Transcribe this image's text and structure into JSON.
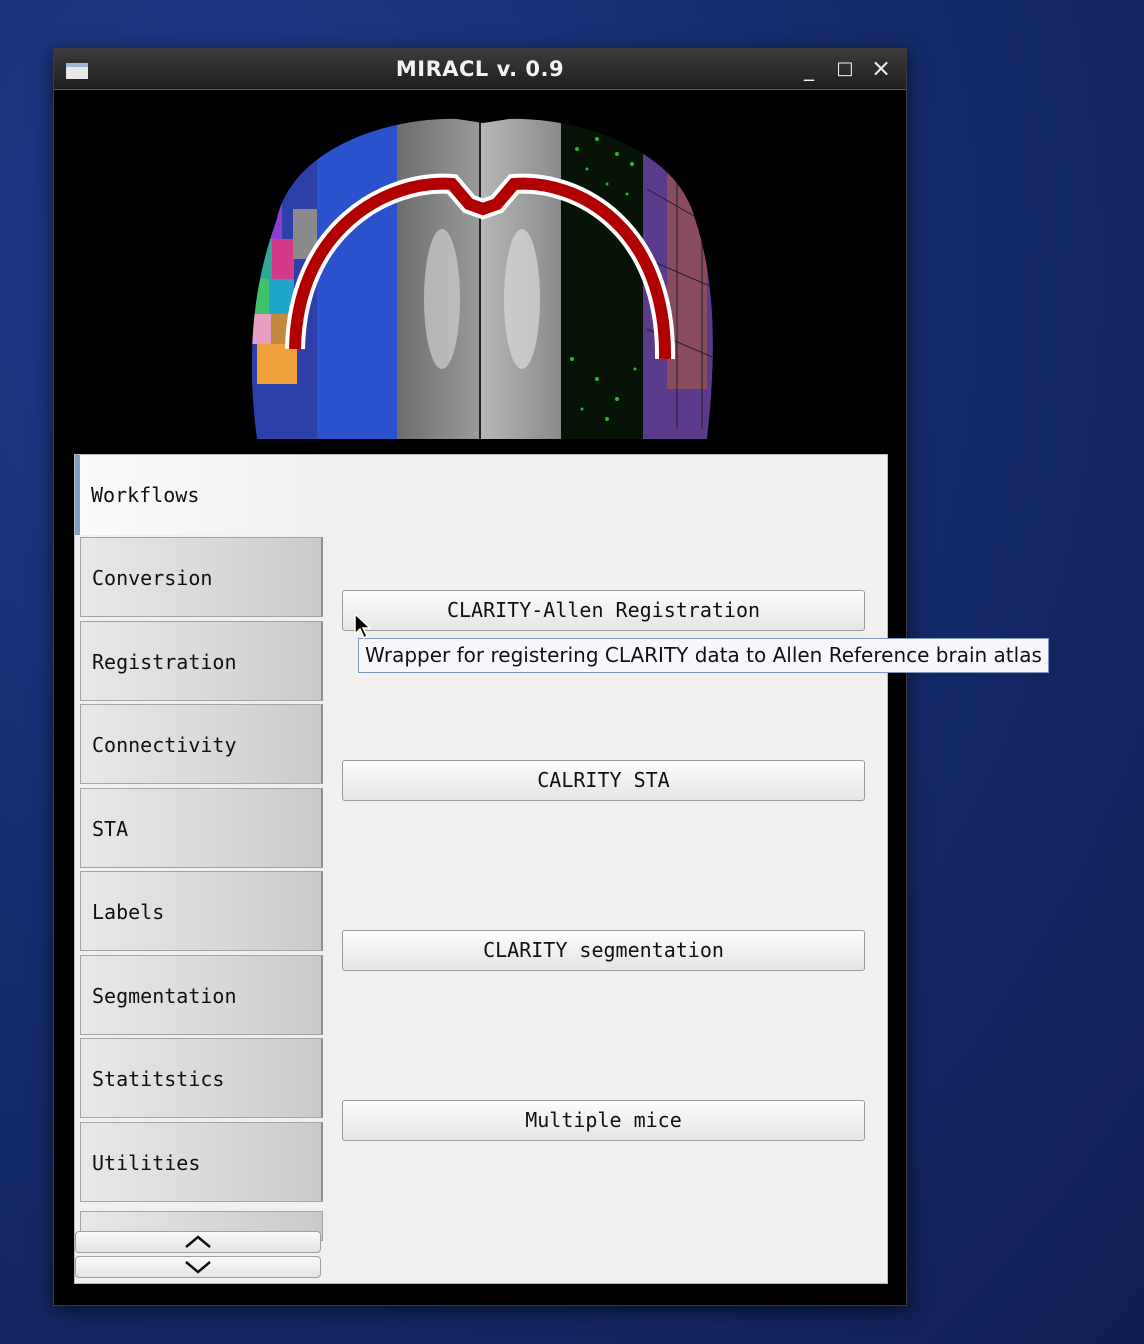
{
  "window": {
    "title": "MIRACL v. 0.9",
    "controls": {
      "minimize": "_",
      "maximize": "□",
      "close": "×"
    }
  },
  "tabs": [
    {
      "label": "Workflows",
      "active": true
    },
    {
      "label": "Conversion"
    },
    {
      "label": "Registration"
    },
    {
      "label": "Connectivity"
    },
    {
      "label": "STA"
    },
    {
      "label": "Labels"
    },
    {
      "label": "Segmentation"
    },
    {
      "label": "Statitstics"
    },
    {
      "label": "Utilities"
    }
  ],
  "buttons": [
    {
      "label": "CLARITY-Allen Registration"
    },
    {
      "label": "CALRITY STA"
    },
    {
      "label": "CLARITY segmentation"
    },
    {
      "label": "Multiple mice"
    }
  ],
  "tooltip": {
    "text": "Wrapper for registering CLARITY data to Allen Reference brain atlas"
  },
  "icons": {
    "scroll_up": "chevron-up-icon",
    "scroll_down": "chevron-down-icon"
  },
  "colors": {
    "desktop": "#152c6e",
    "tab_active_accent": "#7d9fc8",
    "banner_band": "#b00000"
  }
}
